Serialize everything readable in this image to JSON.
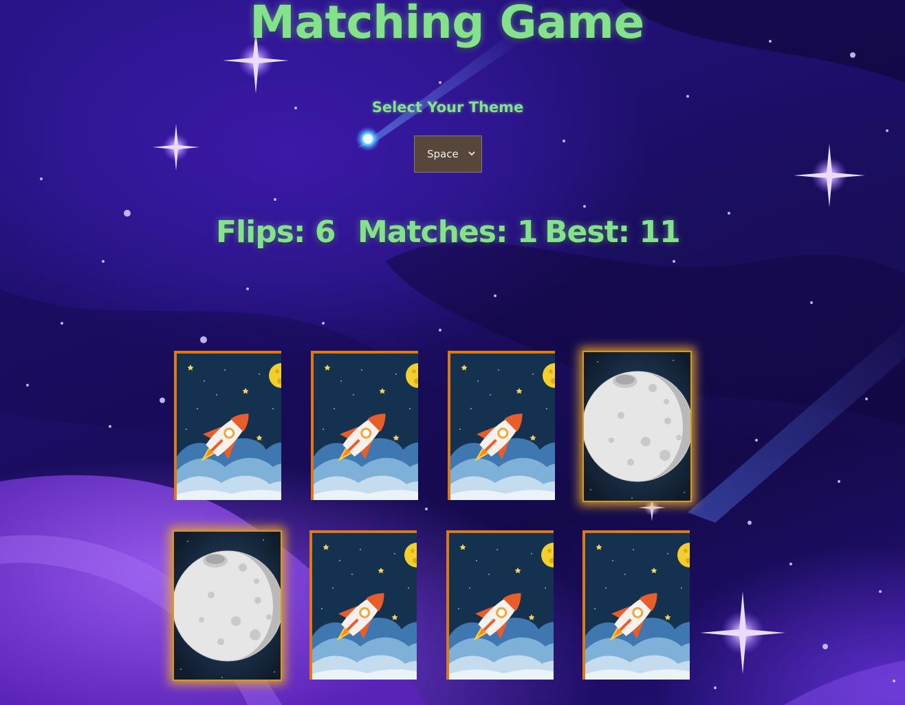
{
  "app": {
    "title": "Matching Game"
  },
  "theme": {
    "label": "Select Your Theme",
    "selected": "Space"
  },
  "stats": {
    "flips": "Flips: 6",
    "matches": "Matches: 1",
    "best": "Best: 11"
  },
  "cards": [
    {
      "state": "face-down",
      "image": "rocket-icon"
    },
    {
      "state": "face-down",
      "image": "rocket-icon"
    },
    {
      "state": "face-down",
      "image": "rocket-icon"
    },
    {
      "state": "matched",
      "image": "moon-icon"
    },
    {
      "state": "matched",
      "image": "moon-icon"
    },
    {
      "state": "face-down",
      "image": "rocket-icon"
    },
    {
      "state": "face-down",
      "image": "rocket-icon"
    },
    {
      "state": "face-down",
      "image": "rocket-icon"
    }
  ],
  "colors": {
    "accent_text": "#84e28c",
    "card_border": "#e07a10",
    "matched_glow": "#e6aa28",
    "background": "#1c0e66"
  }
}
